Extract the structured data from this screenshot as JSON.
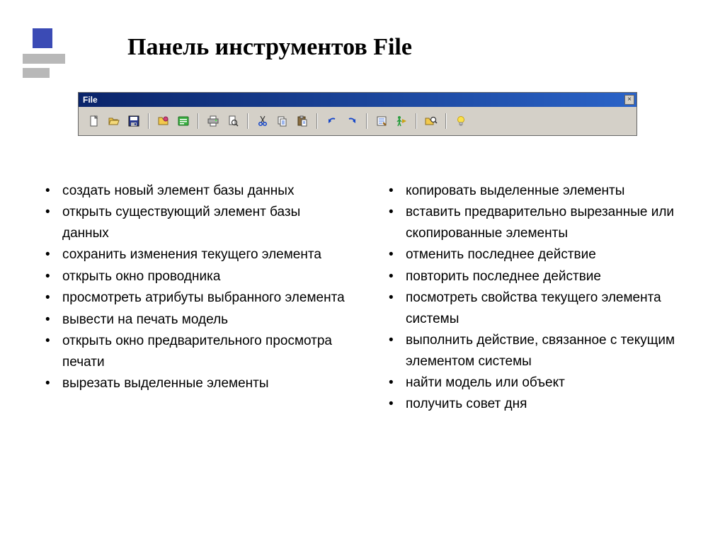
{
  "title": "Панель инструментов File",
  "toolbar": {
    "title": "File",
    "close": "×",
    "icons": [
      {
        "name": "new-icon"
      },
      {
        "name": "open-icon"
      },
      {
        "name": "save-icon"
      },
      {
        "sep": true
      },
      {
        "name": "explorer-icon"
      },
      {
        "name": "attributes-icon"
      },
      {
        "sep": true
      },
      {
        "name": "print-icon"
      },
      {
        "name": "print-preview-icon"
      },
      {
        "sep": true
      },
      {
        "name": "cut-icon"
      },
      {
        "name": "copy-icon"
      },
      {
        "name": "paste-icon"
      },
      {
        "sep": true
      },
      {
        "name": "undo-icon"
      },
      {
        "name": "redo-icon"
      },
      {
        "sep": true
      },
      {
        "name": "properties-icon"
      },
      {
        "name": "run-action-icon"
      },
      {
        "sep": true
      },
      {
        "name": "find-icon"
      },
      {
        "sep": true
      },
      {
        "name": "tip-icon"
      }
    ]
  },
  "left_list": [
    "создать новый элемент базы данных",
    "открыть существующий элемент базы данных",
    "сохранить изменения текущего элемента",
    "открыть окно проводника",
    "просмотреть атрибуты выбранного элемента",
    "вывести на печать модель",
    "открыть окно предварительного просмотра печати",
    "вырезать выделенные элементы"
  ],
  "right_list": [
    "копировать выделенные элементы",
    "вставить предварительно вырезанные или скопированные элементы",
    "отменить последнее действие",
    "повторить последнее действие",
    "посмотреть свойства текущего элемента системы",
    "выполнить действие, связанное с текущим элементом системы",
    "найти модель или объект",
    "получить совет дня"
  ]
}
